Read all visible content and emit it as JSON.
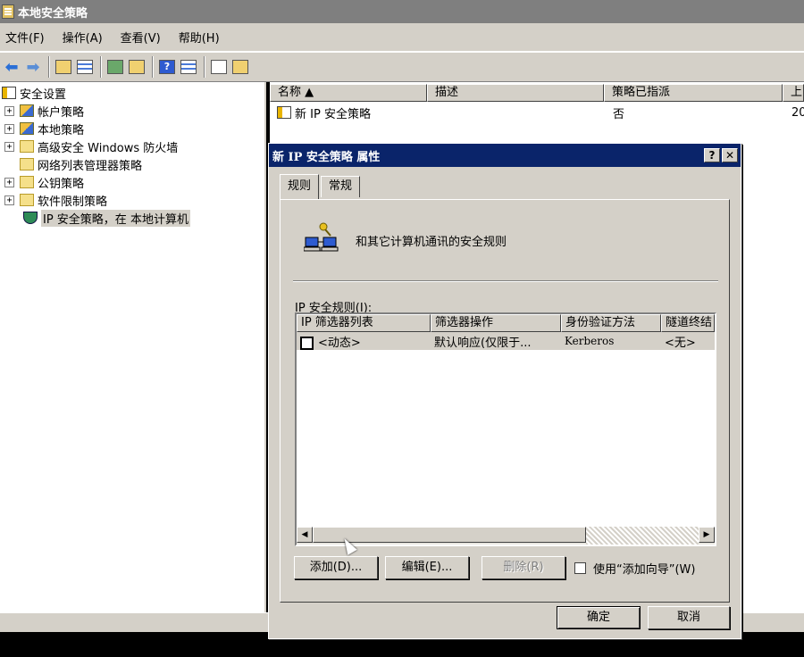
{
  "window": {
    "title": "本地安全策略"
  },
  "menu": [
    {
      "label": "文件(F)"
    },
    {
      "label": "操作(A)"
    },
    {
      "label": "查看(V)"
    },
    {
      "label": "帮助(H)"
    }
  ],
  "tree": [
    {
      "label": "安全设置",
      "expander": "",
      "icon": "policy-icon"
    },
    {
      "label": "帐户策略",
      "expander": "+",
      "icon": "policy-folder-icon"
    },
    {
      "label": "本地策略",
      "expander": "+",
      "icon": "policy-folder-icon"
    },
    {
      "label": "高级安全 Windows 防火墙",
      "expander": "+",
      "icon": "folder-icon"
    },
    {
      "label": "网络列表管理器策略",
      "expander": "",
      "icon": "folder-icon"
    },
    {
      "label": "公钥策略",
      "expander": "+",
      "icon": "folder-icon"
    },
    {
      "label": "软件限制策略",
      "expander": "+",
      "icon": "folder-icon"
    },
    {
      "label": "IP 安全策略，在 本地计算机",
      "expander": "",
      "icon": "ip-security-icon",
      "selected": true
    }
  ],
  "list": {
    "columns": [
      "名称 ▲",
      "描述",
      "策略已指派",
      "上"
    ],
    "rows": [
      {
        "name": "新 IP 安全策略",
        "description": "",
        "assigned": "否",
        "modified": "20"
      }
    ]
  },
  "dialog": {
    "title": "新 IP 安全策略 属性",
    "help_button": "?",
    "close_button": "✕",
    "tabs": [
      "规则",
      "常规"
    ],
    "description": "和其它计算机通讯的安全规则",
    "rules_label": "IP 安全规则(I):",
    "rules_columns": [
      "IP 筛选器列表",
      "筛选器操作",
      "身份验证方法",
      "隧道终结"
    ],
    "rules": [
      {
        "filter_list": "<动态>",
        "filter_action": "默认响应(仅限于...",
        "auth": "Kerberos",
        "tunnel": "<无>",
        "checked": false
      }
    ],
    "buttons": {
      "add": "添加(D)...",
      "edit": "编辑(E)...",
      "remove": "删除(R)",
      "wizard": "使用“添加向导”(W)",
      "ok": "确定",
      "cancel": "取消"
    }
  }
}
